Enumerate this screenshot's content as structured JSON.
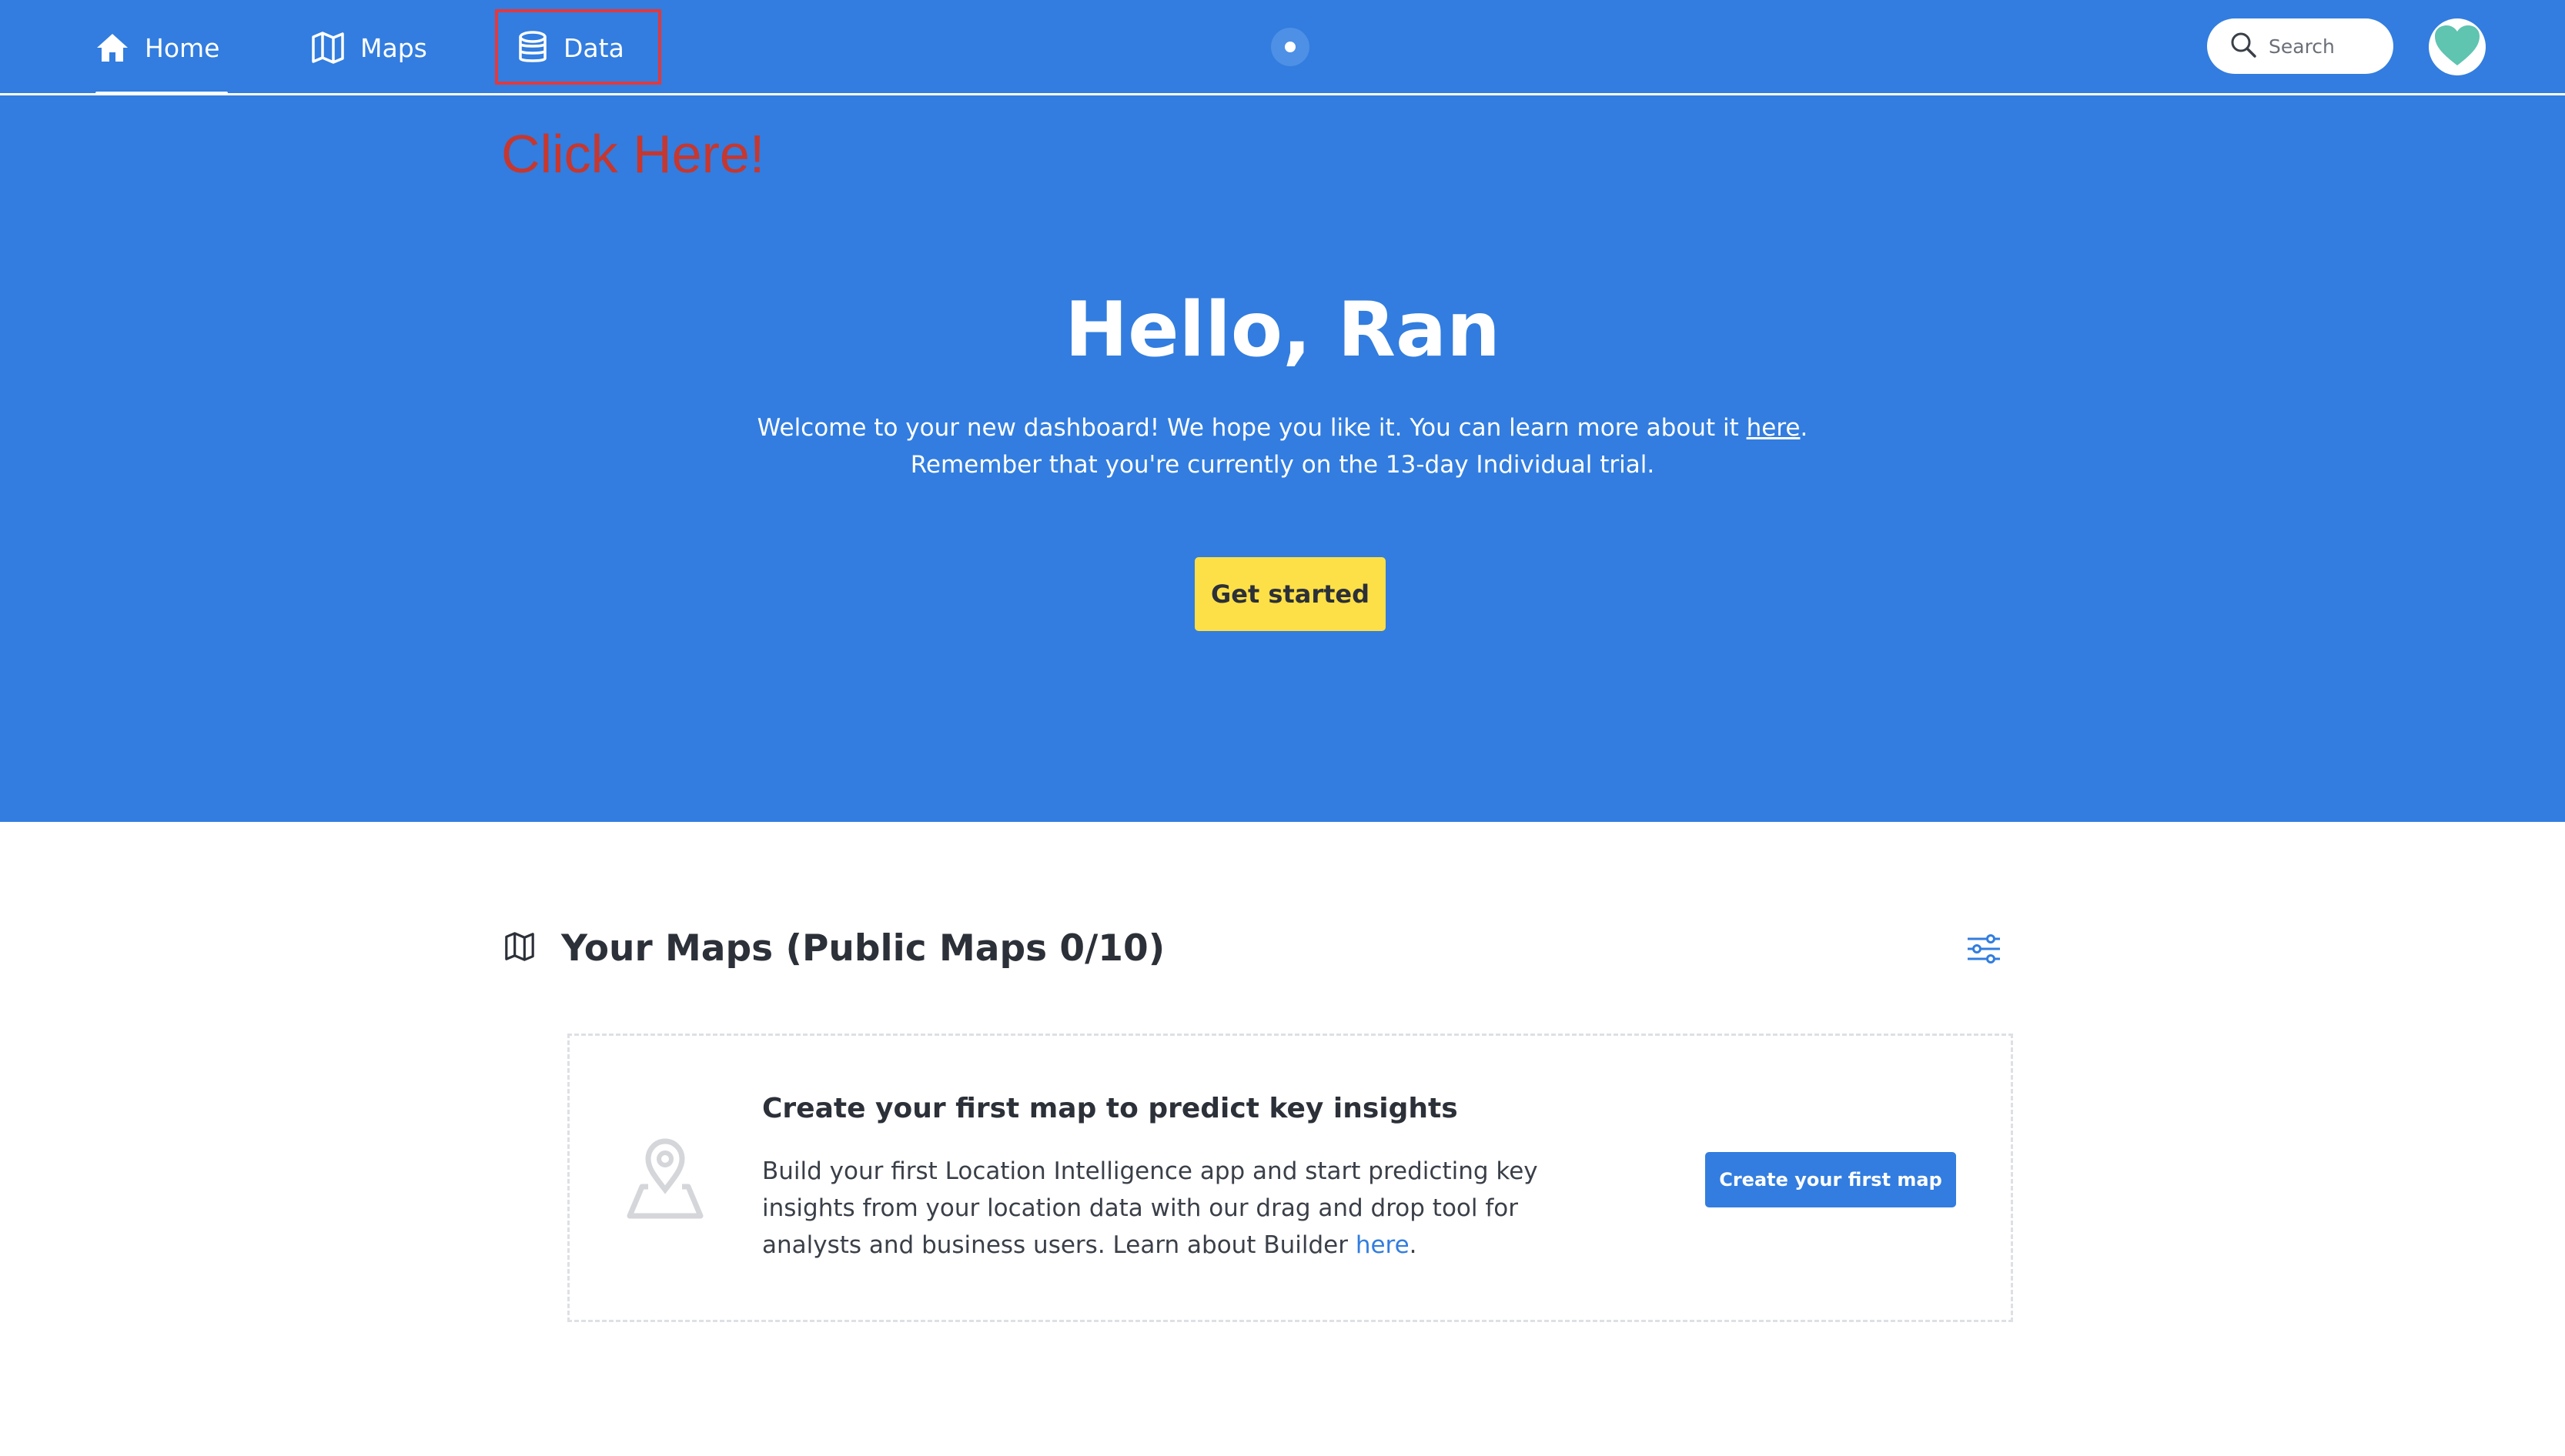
{
  "nav": {
    "items": [
      {
        "label": "Home",
        "icon": "home-icon",
        "active": true
      },
      {
        "label": "Maps",
        "icon": "map-icon"
      },
      {
        "label": "Data",
        "icon": "database-icon"
      }
    ],
    "search_placeholder": "Search",
    "avatar_icon": "heart-icon"
  },
  "annotation": {
    "click_here": "Click Here!"
  },
  "hero": {
    "title": "Hello, Ran",
    "text_line1_prefix": "Welcome to your new dashboard! We hope you like it. You can learn more about it ",
    "text_line1_link": "here",
    "text_line1_suffix": ".",
    "text_line2": "Remember that you're currently on the 13-day Individual trial.",
    "cta_label": "Get started"
  },
  "maps_section": {
    "title": "Your Maps (Public Maps 0/10)",
    "empty_title": "Create your first map to predict key insights",
    "empty_text": "Build your first Location Intelligence app and start predicting key insights from your location data with our drag and drop tool for analysts and business users. Learn about Builder ",
    "empty_link": "here",
    "empty_suffix": ".",
    "create_button": "Create your first map"
  },
  "colors": {
    "primary": "#327ddf",
    "cta": "#fde047",
    "annotation": "#c6372f",
    "avatar_heart": "#5fc4b0"
  }
}
